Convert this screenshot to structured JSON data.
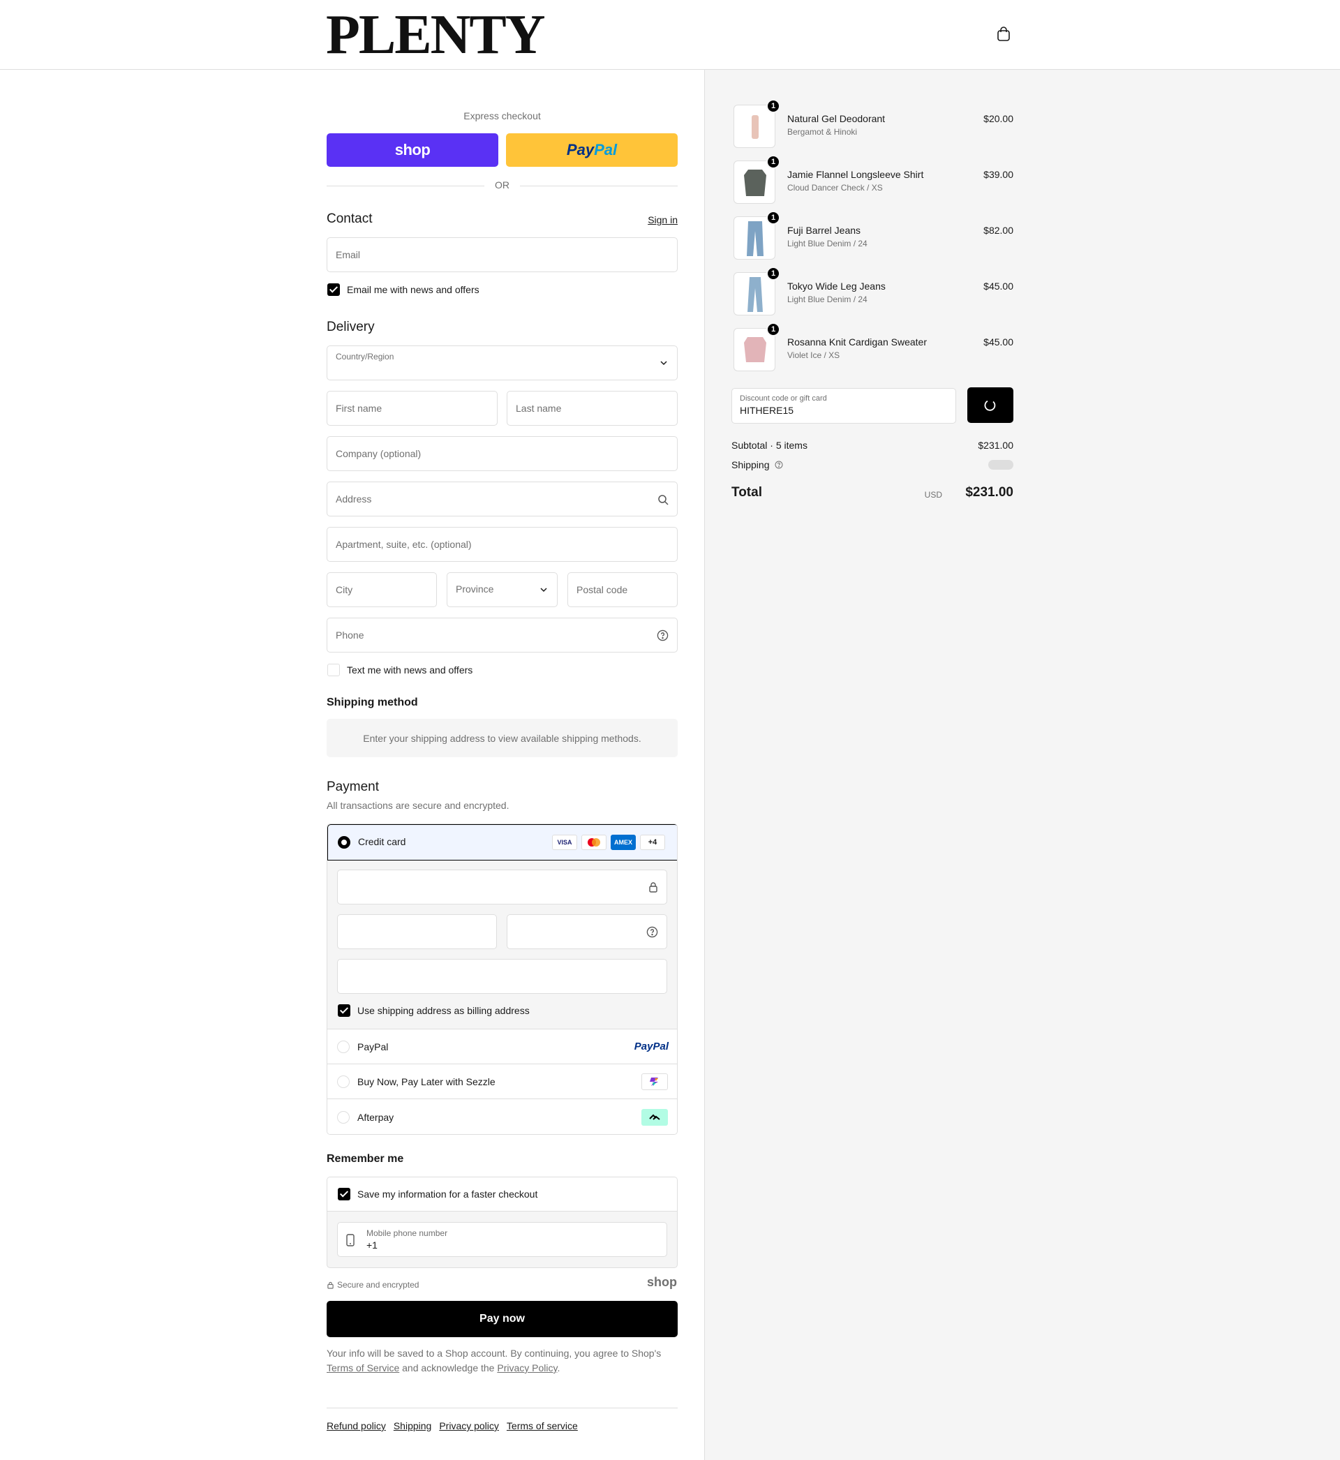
{
  "header": {
    "logo": "PLENTY",
    "cart_icon": "shopping-bag-icon"
  },
  "express": {
    "title": "Express checkout",
    "shop_label": "shop",
    "paypal_a": "Pay",
    "paypal_b": "Pal",
    "or": "OR"
  },
  "contact": {
    "title": "Contact",
    "signin": "Sign in",
    "email_ph": "Email",
    "news_label": "Email me with news and offers",
    "news_checked": true
  },
  "delivery": {
    "title": "Delivery",
    "country_label": "Country/Region",
    "first_ph": "First name",
    "last_ph": "Last name",
    "company_ph": "Company (optional)",
    "address_ph": "Address",
    "apt_ph": "Apartment, suite, etc. (optional)",
    "city_ph": "City",
    "province_ph": "Province",
    "postal_ph": "Postal code",
    "phone_ph": "Phone",
    "text_label": "Text me with news and offers",
    "text_checked": false
  },
  "shipping_method": {
    "title": "Shipping method",
    "message": "Enter your shipping address to view available shipping methods."
  },
  "payment": {
    "title": "Payment",
    "subtitle": "All transactions are secure and encrypted.",
    "credit_card": "Credit card",
    "cards": [
      "VISA",
      "MC",
      "AMEX",
      "+4"
    ],
    "billing_label": "Use shipping address as billing address",
    "billing_checked": true,
    "paypal": "PayPal",
    "paypal_logo": "PayPal",
    "sezzle": "Buy Now, Pay Later with Sezzle",
    "afterpay": "Afterpay",
    "selected": "credit_card"
  },
  "remember": {
    "title": "Remember me",
    "save_label": "Save my information for a faster checkout",
    "save_checked": true,
    "mobile_label": "Mobile phone number",
    "mobile_value": "+1",
    "secure": "Secure and encrypted",
    "shop": "shop"
  },
  "pay_now": "Pay now",
  "fine_print": {
    "a": "Your info will be saved to a Shop account. By continuing, you agree to Shop's ",
    "tos": "Terms of Service",
    "b": " and acknowledge the ",
    "privacy": "Privacy Policy",
    "c": "."
  },
  "footer": {
    "links": [
      "Refund policy",
      "Shipping",
      "Privacy policy",
      "Terms of service"
    ]
  },
  "cart": {
    "items": [
      {
        "name": "Natural Gel Deodorant",
        "variant": "Bergamot & Hinoki",
        "price": "$20.00",
        "qty": "1",
        "color": "#e8c4b8"
      },
      {
        "name": "Jamie Flannel Longsleeve Shirt",
        "variant": "Cloud Dancer Check / XS",
        "price": "$39.00",
        "qty": "1",
        "color": "#5b625c"
      },
      {
        "name": "Fuji Barrel Jeans",
        "variant": "Light Blue Denim / 24",
        "price": "$82.00",
        "qty": "1",
        "color": "#7ea3c4"
      },
      {
        "name": "Tokyo Wide Leg Jeans",
        "variant": "Light Blue Denim / 24",
        "price": "$45.00",
        "qty": "1",
        "color": "#8eb0cc"
      },
      {
        "name": "Rosanna Knit Cardigan Sweater",
        "variant": "Violet Ice / XS",
        "price": "$45.00",
        "qty": "1",
        "color": "#e2b4b8"
      }
    ],
    "discount_label": "Discount code or gift card",
    "discount_value": "HITHERE15",
    "subtotal_label": "Subtotal · 5 items",
    "subtotal": "$231.00",
    "shipping_label": "Shipping",
    "total_label": "Total",
    "currency": "USD",
    "total": "$231.00"
  },
  "colors": {
    "shop_purple": "#5a31f4",
    "paypal_yellow": "#ffc439",
    "black": "#000000"
  }
}
